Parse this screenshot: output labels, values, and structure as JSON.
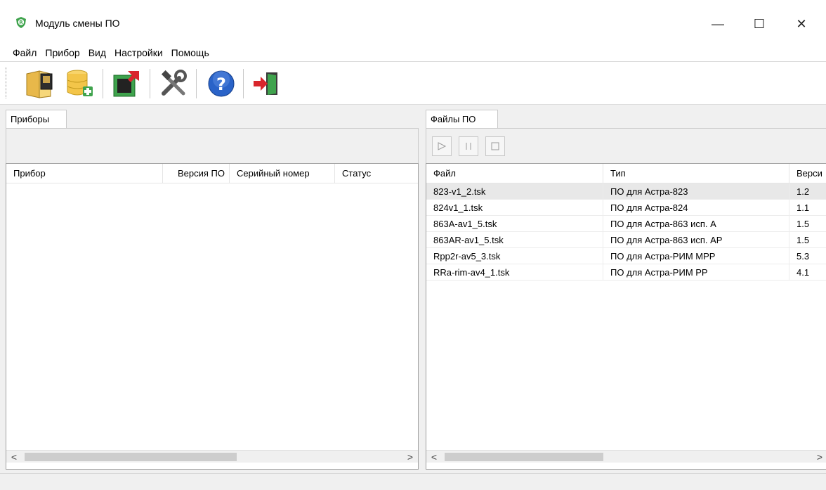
{
  "window": {
    "title": "Модуль смены ПО",
    "minimize": "—",
    "maximize": "☐",
    "close": "✕"
  },
  "menu": [
    "Файл",
    "Прибор",
    "Вид",
    "Настройки",
    "Помощь"
  ],
  "toolbar": [
    {
      "icon": "folder-device-icon"
    },
    {
      "icon": "database-add-icon"
    },
    {
      "icon": "chip-flash-icon"
    },
    {
      "icon": "tools-icon"
    },
    {
      "icon": "help-icon"
    },
    {
      "icon": "exit-icon"
    }
  ],
  "left_panel": {
    "tab": "Приборы",
    "columns": [
      "Прибор",
      "Версия ПО",
      "Серийный номер",
      "Статус"
    ],
    "rows": []
  },
  "right_panel": {
    "tab": "Файлы ПО",
    "controls": [
      "play-icon",
      "pause-icon",
      "stop-icon"
    ],
    "columns": [
      "Файл",
      "Тип",
      "Верси"
    ],
    "rows": [
      {
        "file": "823-v1_2.tsk",
        "type": "ПО для Астра-823",
        "version": "1.2"
      },
      {
        "file": "824v1_1.tsk",
        "type": "ПО для Астра-824",
        "version": "1.1"
      },
      {
        "file": "863A-av1_5.tsk",
        "type": "ПО для Астра-863 исп. А",
        "version": "1.5"
      },
      {
        "file": "863AR-av1_5.tsk",
        "type": "ПО для Астра-863 исп. АР",
        "version": "1.5"
      },
      {
        "file": "Rpp2r-av5_3.tsk",
        "type": "ПО для Астра-РИМ МРР",
        "version": "5.3"
      },
      {
        "file": "RRa-rim-av4_1.tsk",
        "type": "ПО для Астра-РИМ РР",
        "version": "4.1"
      }
    ]
  },
  "scroll": {
    "left": "<",
    "right": ">"
  },
  "colors": {
    "accent_green": "#3fa34d",
    "help_blue": "#2a63c8",
    "exit_red": "#d9262c"
  }
}
